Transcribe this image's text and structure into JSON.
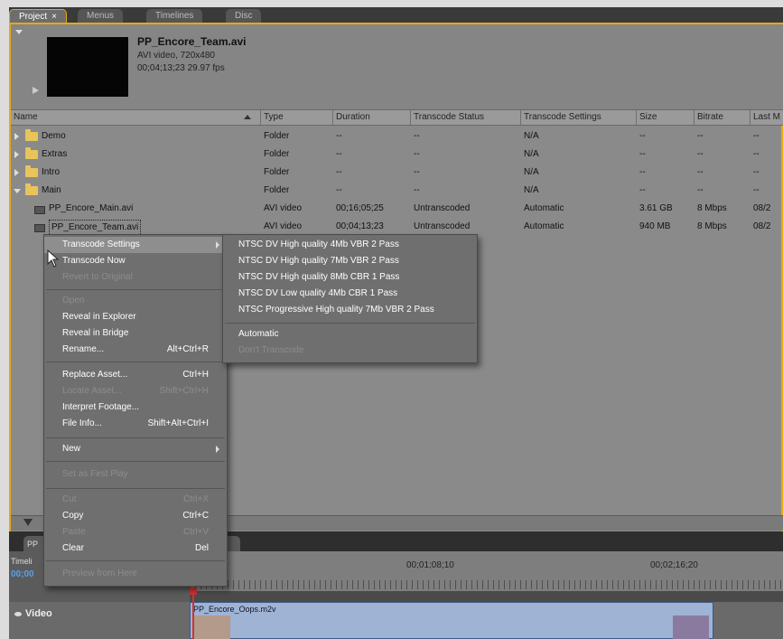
{
  "tabs": [
    {
      "label": "Project",
      "close": "×",
      "active": true
    },
    {
      "label": "Menus"
    },
    {
      "label": "Timelines"
    },
    {
      "label": "Disc"
    }
  ],
  "preview": {
    "name": "PP_Encore_Team.avi",
    "info": "AVI video, 720x480",
    "timing": "00;04;13;23  29.97 fps"
  },
  "columns": [
    "Name",
    "Type",
    "Duration",
    "Transcode Status",
    "Transcode Settings",
    "Size",
    "Bitrate",
    "Last M"
  ],
  "rows": [
    {
      "name": "Demo",
      "kind": "folder",
      "type": "Folder",
      "duration": "--",
      "status": "--",
      "settings": "N/A",
      "size": "--",
      "bitrate": "--",
      "last": "--"
    },
    {
      "name": "Extras",
      "kind": "folder",
      "type": "Folder",
      "duration": "--",
      "status": "--",
      "settings": "N/A",
      "size": "--",
      "bitrate": "--",
      "last": "--"
    },
    {
      "name": "Intro",
      "kind": "folder",
      "type": "Folder",
      "duration": "--",
      "status": "--",
      "settings": "N/A",
      "size": "--",
      "bitrate": "--",
      "last": "--"
    },
    {
      "name": "Main",
      "kind": "folder-open",
      "type": "Folder",
      "duration": "--",
      "status": "--",
      "settings": "N/A",
      "size": "--",
      "bitrate": "--",
      "last": "--"
    },
    {
      "name": "PP_Encore_Main.avi",
      "kind": "file",
      "type": "AVI video",
      "duration": "00;16;05;25",
      "status": "Untranscoded",
      "settings": "Automatic",
      "size": "3.61 GB",
      "bitrate": "8 Mbps",
      "last": "08/2"
    },
    {
      "name": "PP_Encore_Team.avi",
      "kind": "file",
      "type": "AVI video",
      "duration": "00;04;13;23",
      "status": "Untranscoded",
      "settings": "Automatic",
      "size": "940 MB",
      "bitrate": "8 Mbps",
      "last": "08/2"
    }
  ],
  "context_menu": [
    {
      "label": "Transcode Settings",
      "submenu": true,
      "highlighted": true
    },
    {
      "label": "Transcode Now"
    },
    {
      "label": "Revert to Original",
      "disabled": true
    },
    {
      "separator": true
    },
    {
      "label": "Open",
      "disabled": true
    },
    {
      "label": "Reveal in Explorer"
    },
    {
      "label": "Reveal in Bridge"
    },
    {
      "label": "Rename...",
      "shortcut": "Alt+Ctrl+R"
    },
    {
      "separator": true
    },
    {
      "label": "Replace Asset...",
      "shortcut": "Ctrl+H"
    },
    {
      "label": "Locate Asset...",
      "shortcut": "Shift+Ctrl+H",
      "disabled": true
    },
    {
      "label": "Interpret Footage..."
    },
    {
      "label": "File Info...",
      "shortcut": "Shift+Alt+Ctrl+I"
    },
    {
      "separator": true
    },
    {
      "label": "New",
      "submenu": true
    },
    {
      "separator": true
    },
    {
      "label": "Set as First Play",
      "disabled": true
    },
    {
      "separator": true
    },
    {
      "label": "Cut",
      "shortcut": "Ctrl+X",
      "disabled": true
    },
    {
      "label": "Copy",
      "shortcut": "Ctrl+C"
    },
    {
      "label": "Paste",
      "shortcut": "Ctrl+V",
      "disabled": true
    },
    {
      "label": "Clear",
      "shortcut": "Del"
    },
    {
      "separator": true
    },
    {
      "label": "Preview from Here",
      "disabled": true
    }
  ],
  "submenu": [
    {
      "label": "NTSC DV High quality 4Mb VBR 2 Pass"
    },
    {
      "label": "NTSC DV High quality 7Mb VBR 2 Pass"
    },
    {
      "label": "NTSC DV High quality 8Mb CBR 1 Pass"
    },
    {
      "label": "NTSC DV Low quality 4Mb CBR 1 Pass"
    },
    {
      "label": "NTSC Progressive High quality 7Mb VBR 2 Pass"
    },
    {
      "separator": true
    },
    {
      "label": "Automatic"
    },
    {
      "label": "Don't Transcode",
      "disabled": true
    }
  ],
  "timeline": {
    "tab_label": "PP",
    "label": "Timeli",
    "timecode": "00;00",
    "ruler": [
      "00;01;08;10",
      "00;02;16;20"
    ],
    "track_label": "Video",
    "clip_name": "PP_Encore_Oops.m2v"
  },
  "colors": {
    "accent": "#e6a817",
    "panel": "#8a8a8a",
    "menu": "#6f6f6f",
    "highlight": "#8e8e8e"
  }
}
